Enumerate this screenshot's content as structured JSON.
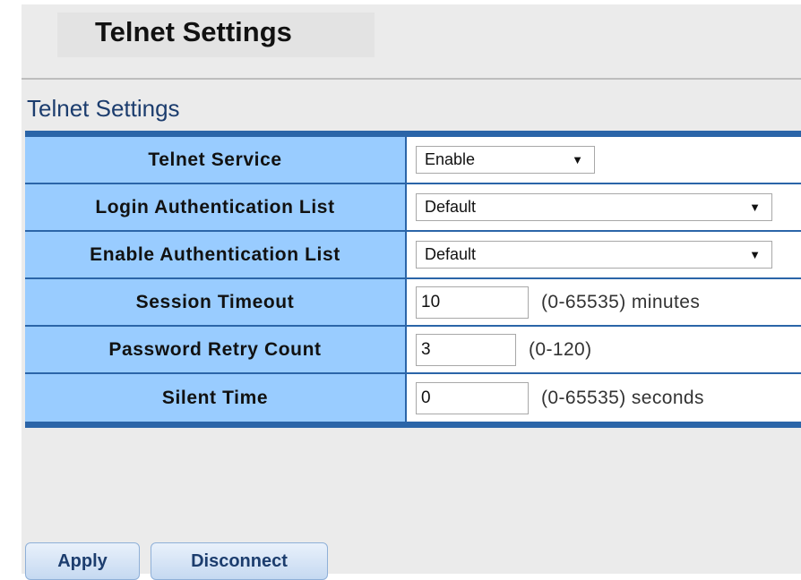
{
  "header": {
    "title": "Telnet Settings"
  },
  "section": {
    "title": "Telnet Settings"
  },
  "rows": [
    {
      "label": "Telnet Service",
      "type": "select",
      "value": "Enable"
    },
    {
      "label": "Login Authentication List",
      "type": "select",
      "value": "Default"
    },
    {
      "label": "Enable Authentication List",
      "type": "select",
      "value": "Default"
    },
    {
      "label": "Session Timeout",
      "type": "input",
      "value": "10",
      "range": "(0-65535) minutes"
    },
    {
      "label": "Password Retry Count",
      "type": "input",
      "value": "3",
      "range": "(0-120)"
    },
    {
      "label": "Silent Time",
      "type": "input",
      "value": "0",
      "range": "(0-65535) seconds"
    }
  ],
  "buttons": {
    "apply": "Apply",
    "disconnect": "Disconnect"
  },
  "icons": {
    "dropdown": "chevron-down-icon"
  },
  "colors": {
    "table_border": "#2b65a8",
    "label_background": "#99ccff",
    "section_title": "#1c3d6e",
    "button_text": "#1c3d6e"
  }
}
